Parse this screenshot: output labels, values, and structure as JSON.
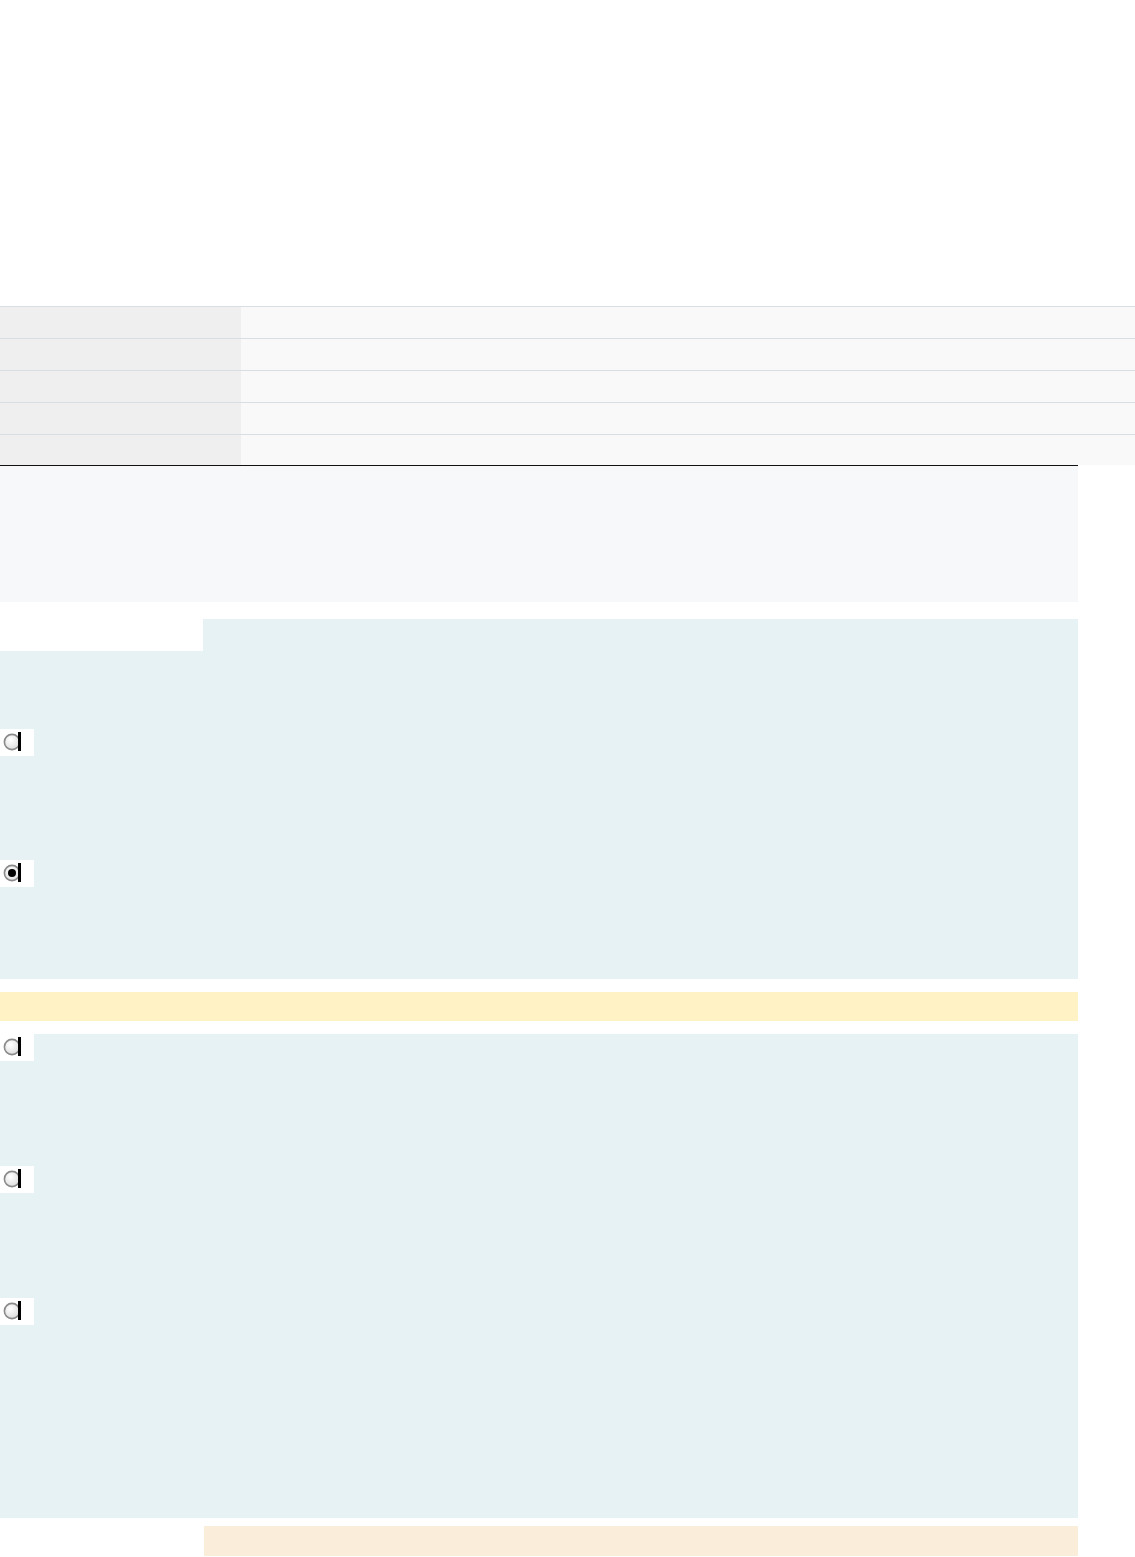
{
  "questions": [
    {
      "kind": "headed",
      "options": [
        {
          "selected": false
        },
        {
          "selected": true
        }
      ]
    },
    {
      "kind": "plain",
      "options": [
        {
          "selected": false
        },
        {
          "selected": false
        },
        {
          "selected": false
        }
      ]
    }
  ]
}
